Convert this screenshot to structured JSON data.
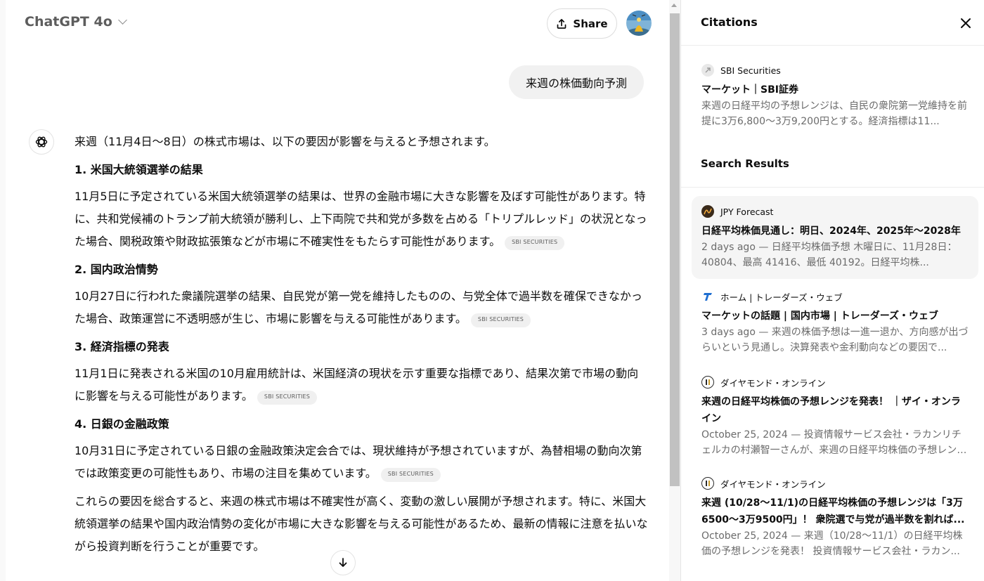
{
  "header": {
    "model_name": "ChatGPT 4o",
    "share_label": "Share"
  },
  "chat": {
    "user_message": "来週の株価動向予測",
    "intro": "来週（11月4日～8日）の株式市場は、以下の要因が影響を与えると予想されます。",
    "sections": [
      {
        "heading": "1. 米国大統領選挙の結果",
        "body": "11月5日に予定されている米国大統領選挙の結果は、世界の金融市場に大きな影響を及ぼす可能性があります。特に、共和党候補のトランプ前大統領が勝利し、上下両院で共和党が多数を占める「トリプルレッド」の状況となった場合、関税政策や財政拡張策などが市場に不確実性をもたらす可能性があります。",
        "citation": "SBI SECURITIES"
      },
      {
        "heading": "2. 国内政治情勢",
        "body": "10月27日に行われた衆議院選挙の結果、自民党が第一党を維持したものの、与党全体で過半数を確保できなかった場合、政策運営に不透明感が生じ、市場に影響を与える可能性があります。",
        "citation": "SBI SECURITIES"
      },
      {
        "heading": "3. 経済指標の発表",
        "body": "11月1日に発表される米国の10月雇用統計は、米国経済の現状を示す重要な指標であり、結果次第で市場の動向に影響を与える可能性があります。",
        "citation": "SBI SECURITIES"
      },
      {
        "heading": "4. 日銀の金融政策",
        "body": "10月31日に予定されている日銀の金融政策決定会合では、現状維持が予想されていますが、為替相場の動向次第では政策変更の可能性もあり、市場の注目を集めています。",
        "citation": "SBI SECURITIES"
      }
    ],
    "conclusion": "これらの要因を総合すると、来週の株式市場は不確実性が高く、変動の激しい展開が予想されます。特に、米国大統領選挙の結果や国内政治情勢の変化が市場に大きな影響を与える可能性があるため、最新の情報に注意を払いながら投資判断を行うことが重要です。"
  },
  "citations_panel": {
    "title": "Citations",
    "citations": [
      {
        "source": "SBI Securities",
        "title": "マーケット｜SBI証券",
        "snippet": "来週の日経平均の予想レンジは、自民の衆院第一党維持を前提に3万6,800～3万9,200円とする。経済指標は11..."
      }
    ],
    "search_results_title": "Search Results",
    "results": [
      {
        "source": "JPY Forecast",
        "title": "日経平均株価見通し：明日、2024年、2025年～2028年",
        "snippet": "2 days ago — 日経平均株価予想 木曜日に、11月28日： 40804、最高 41416、最低 40192。日経平均株..."
      },
      {
        "source": "ホーム | トレーダーズ・ウェブ",
        "title": "マーケットの話題 | 国内市場 | トレーダーズ・ウェブ",
        "snippet": "3 days ago — 来週の株価予想は一進一退か、方向感が出づらいという見通し。決算発表や金利動向などの要因で..."
      },
      {
        "source": "ダイヤモンド・オンライン",
        "title": "来週の日経平均株価の予想レンジを発表！ ｜ザイ・オンライン",
        "snippet": "October 25, 2024 — 投資情報サービス会社・ラカンリチェルカの村瀬智一さんが、来週の日経平均株価の予想レンジ..."
      },
      {
        "source": "ダイヤモンド・オンライン",
        "title": "来週 (10/28～11/1)の日経平均株価の予想レンジは「3万6500～3万9500円」！ 衆院選で与党が過半数を割れば...",
        "snippet": "October 25, 2024 — 来週（10/28～11/1）の日経平均株価の予想レンジを発表！ 投資情報サービス会社・ラカン..."
      }
    ]
  }
}
